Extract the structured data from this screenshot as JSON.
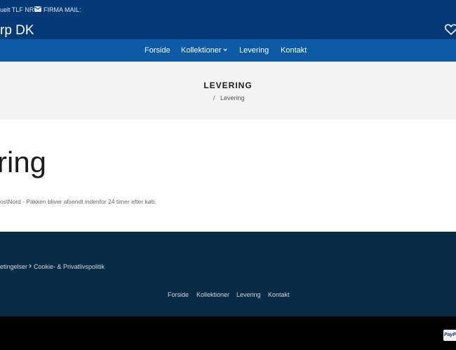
{
  "topbar": {
    "phone_label": "uelt TLF NR:",
    "mail_label": "FIRMA MAIL:"
  },
  "header": {
    "brand": "rp DK"
  },
  "nav": {
    "items": [
      {
        "label": "Forside"
      },
      {
        "label": "Kollektioner"
      },
      {
        "label": "Levering"
      },
      {
        "label": "Kontakt"
      }
    ]
  },
  "page_header": {
    "title": "LEVERING",
    "breadcrumb_sep": "/",
    "breadcrumb_current": "Levering"
  },
  "main": {
    "heading": "ring",
    "text": "ostNord - Pakken bliver afsendt indenfor 24 timer efter køb."
  },
  "footer": {
    "policy_links": [
      "etingelser",
      "Cookie- & Privatlivspolitik"
    ],
    "nav_links": [
      "Forside",
      "Kollektioner",
      "Levering",
      "Kontakt"
    ]
  },
  "bottom": {
    "payment_badge": "PayPal"
  },
  "colors": {
    "topbar": "#043a78",
    "nav": "#0a5aa4",
    "footer": "#072a45",
    "bottom": "#000000"
  }
}
